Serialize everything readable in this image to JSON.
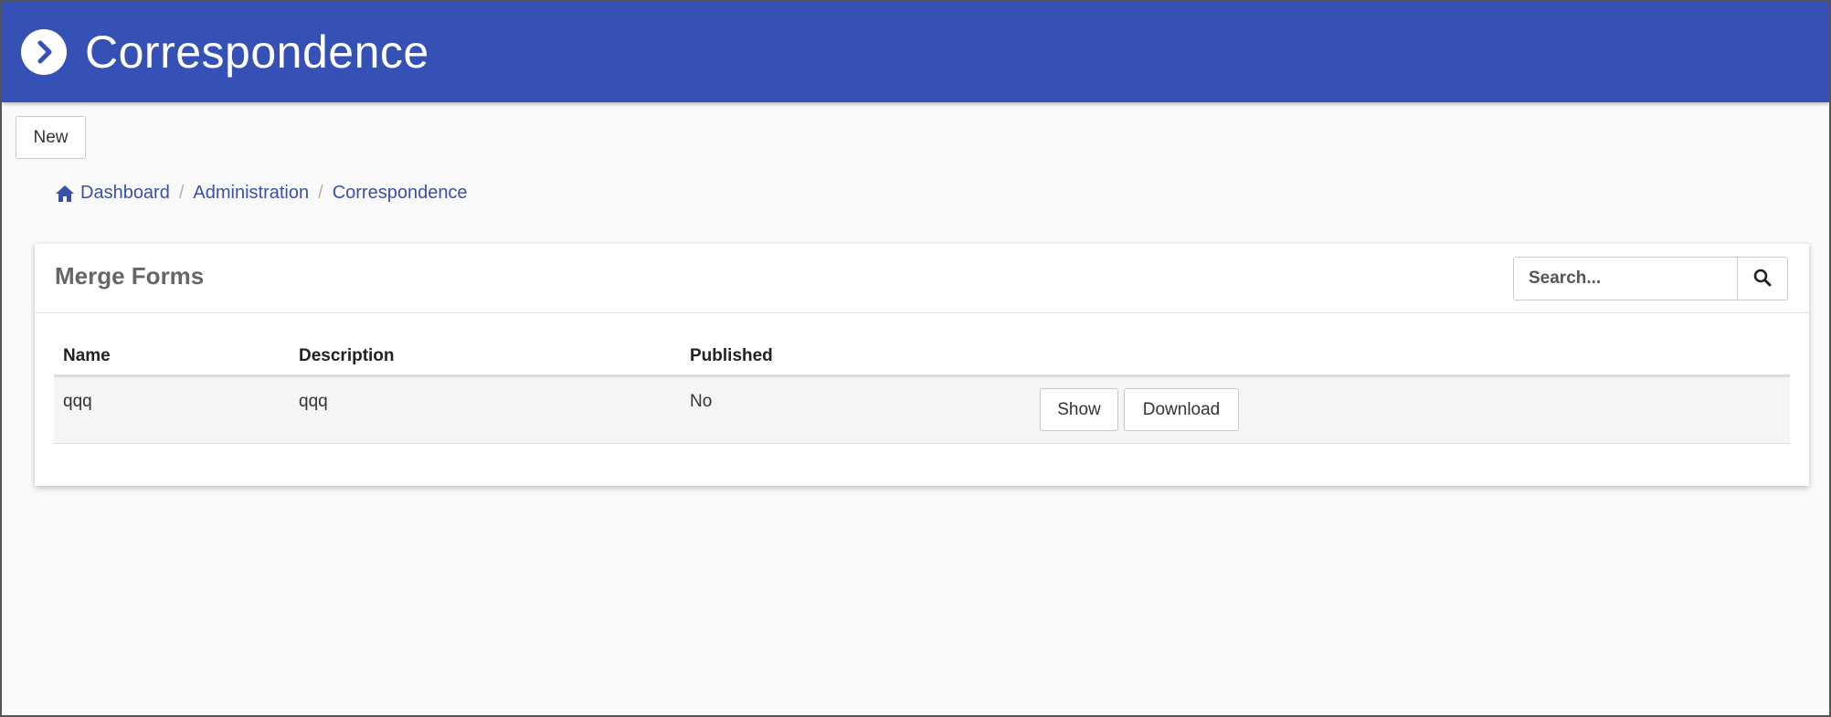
{
  "header": {
    "title": "Correspondence",
    "icon": "chevron-right-circle-icon",
    "color": "#3551b5"
  },
  "toolbar": {
    "new_label": "New"
  },
  "breadcrumb": {
    "home_icon": "home-icon",
    "items": [
      "Dashboard",
      "Administration",
      "Correspondence"
    ],
    "separator": "/"
  },
  "card": {
    "title": "Merge Forms",
    "search": {
      "placeholder": "Search...",
      "icon": "search-icon"
    }
  },
  "table": {
    "columns": [
      "Name",
      "Description",
      "Published"
    ],
    "rows": [
      {
        "name": "qqq",
        "description": "qqq",
        "published": "No",
        "show_label": "Show",
        "download_label": "Download"
      }
    ]
  }
}
